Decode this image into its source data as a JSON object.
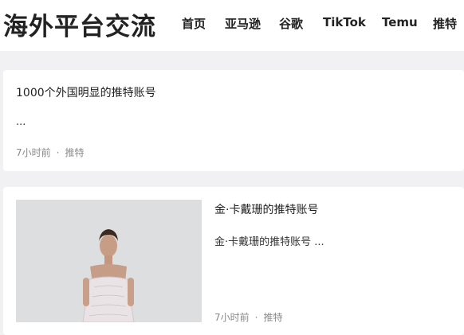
{
  "site": {
    "title": "海外平台交流"
  },
  "nav": [
    "首页",
    "亚马逊",
    "谷歌",
    "TikTok",
    "Temu",
    "推特"
  ],
  "posts": [
    {
      "title": "1000个外国明显的推特账号",
      "excerpt": "...",
      "time": "7小时前",
      "category": "推特"
    },
    {
      "title": "金·卡戴珊的推特账号",
      "excerpt": "金·卡戴珊的推特账号 ...",
      "time": "7小时前",
      "category": "推特"
    }
  ]
}
